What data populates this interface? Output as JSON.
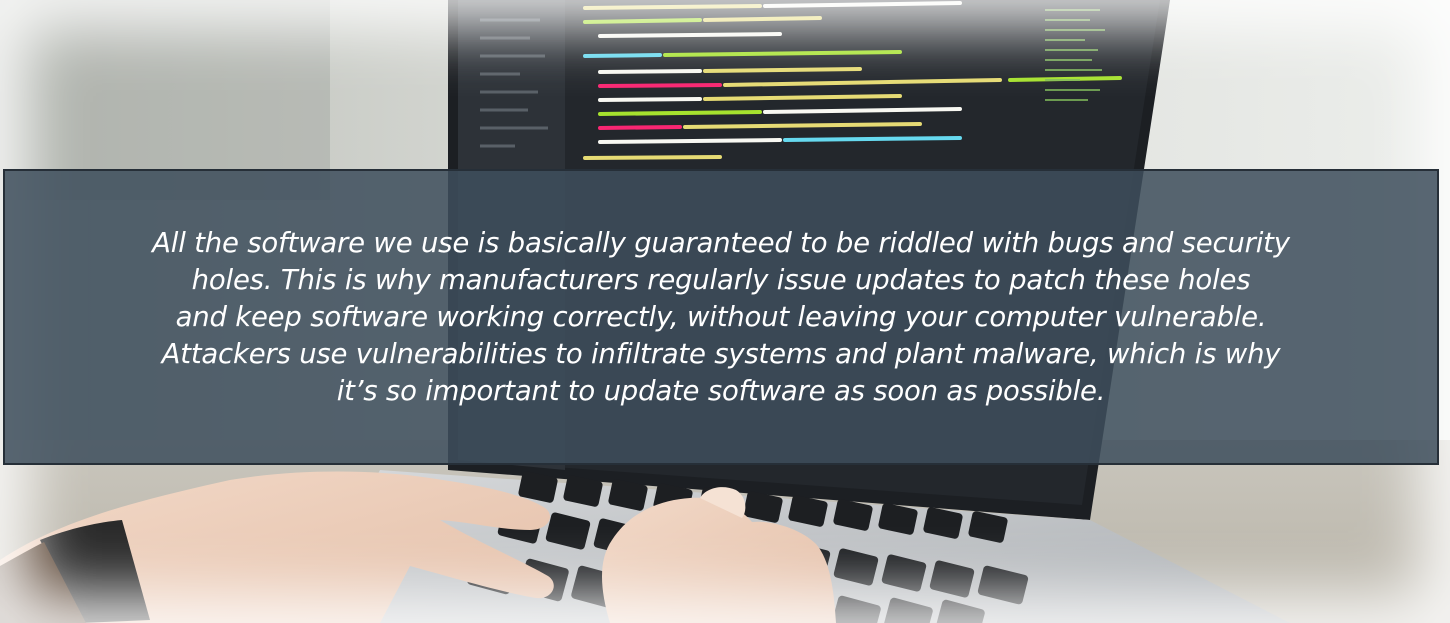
{
  "quote": {
    "lines": [
      "All the software we use is basically guaranteed to be riddled with bugs and security",
      "holes. This is why manufacturers regularly issue updates to patch these holes",
      "and keep software working correctly, without leaving your computer vulnerable.",
      "Attackers use vulnerabilities to infiltrate systems and plant malware, which is why",
      "it’s so important to update software as soon as possible."
    ]
  },
  "background": {
    "scene": "laptop-code-typing-photo"
  },
  "colors": {
    "panel": "#3e4e5c",
    "panel_border": "#262f38",
    "text": "#ffffff"
  }
}
